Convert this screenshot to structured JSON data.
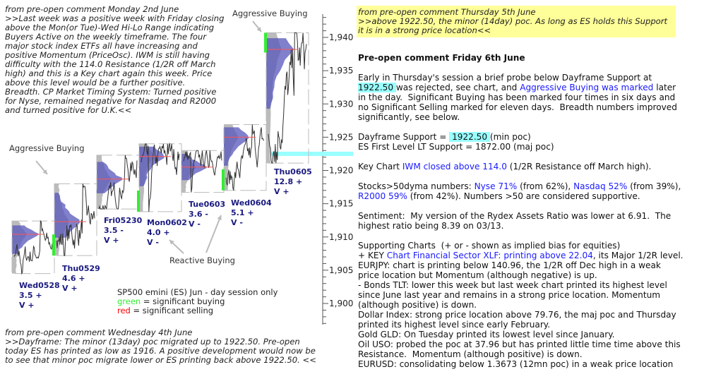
{
  "left_comment": {
    "lines": [
      "from pre-open comment Monday 2nd June",
      ">>Last week was a positive week with Friday closing",
      "above the Mon(or Tue)-Wed Hi-Lo Range indicating",
      "Buyers Active on the weekly timeframe.  The four",
      "major stock index ETFs all have increasing and",
      "positive Momentum (PriceOsc).  IWM is still having",
      "difficulty with the 114.0 Resistance (1/2R off March",
      "high) and this is a Key chart again this week. Price",
      "above this level would be a further positive.",
      "Breadth. CP Market Timing System: Turned positive",
      "for Nyse, remained negative for Nasdaq and R2000",
      "and turned positive for U.K.<<"
    ]
  },
  "bottom_comment": {
    "lines": [
      "from pre-open comment Wednesday 4th June",
      ">>Dayframe: The minor (13day) poc migrated up to 1922.50.  Pre-open",
      "today ES has printed as low as 1916.  A positive development would now be",
      "to see that minor poc migrate lower or ES printing back above 1922.50. <<"
    ]
  },
  "yellow_comment": {
    "background": "#ffff99",
    "lines": [
      "from pre-open comment Thursday 5th June",
      ">>above 1922.50, the minor (14day) poc.  As long as ES holds this Support",
      "it is in a strong price location<<"
    ]
  },
  "right_text": {
    "link_color": "#1a1aff",
    "highlight_color": "#99ffff",
    "blocks": [
      {
        "type": "title",
        "lines": [
          [
            {
              "t": "Pre-open comment Friday 6th June"
            }
          ]
        ]
      },
      {
        "type": "para",
        "lines": [
          [
            {
              "t": "Early in Thursday's session a brief probe below Dayframe Support at"
            }
          ],
          [
            {
              "t": "1922.50 ",
              "s": "hl"
            },
            {
              "t": "was rejected, see chart, and "
            },
            {
              "t": "Aggressive Buying was marked",
              "s": "link"
            },
            {
              "t": " later"
            }
          ],
          [
            {
              "t": "in the day.  Significant Buying has been marked four times in six days and"
            }
          ],
          [
            {
              "t": "no Significant Selling marked for eleven days.  Breadth numbers improved"
            }
          ],
          [
            {
              "t": "significantly, see below."
            }
          ]
        ]
      },
      {
        "type": "para",
        "lines": [
          [
            {
              "t": "Dayframe Support = "
            },
            {
              "t": " 1922.50 ",
              "s": "hl"
            },
            {
              "t": "(min poc)"
            }
          ],
          [
            {
              "t": "ES First Level LT Support = 1872.00 (maj poc)"
            }
          ]
        ]
      },
      {
        "type": "para",
        "lines": [
          [
            {
              "t": "Key Chart "
            },
            {
              "t": "IWM closed above 114.0",
              "s": "link"
            },
            {
              "t": " (1/2R Resistance off March high)."
            }
          ]
        ]
      },
      {
        "type": "para",
        "lines": [
          [
            {
              "t": "Stocks>50dyma numbers: "
            },
            {
              "t": "Nyse 71%",
              "s": "link"
            },
            {
              "t": " (from 62%), "
            },
            {
              "t": "Nasdaq 52%",
              "s": "link"
            },
            {
              "t": " (from 39%),"
            }
          ],
          [
            {
              "t": "R2000 59%",
              "s": "link"
            },
            {
              "t": " (from 42%). Numbers >50 are considered supportive."
            }
          ]
        ]
      },
      {
        "type": "para",
        "lines": [
          [
            {
              "t": "Sentiment:  My version of the Rydex Assets Ratio was lower at 6.91.  The"
            }
          ],
          [
            {
              "t": "highest ratio being 8.39 on 03/13."
            }
          ]
        ]
      },
      {
        "type": "para",
        "lines": [
          [
            {
              "t": "Supporting Charts  (+ or - shown as implied bias for equities)"
            }
          ],
          [
            {
              "t": "+ KEY "
            },
            {
              "t": "Chart Financial Sector XLF: printing above 22.04",
              "s": "link"
            },
            {
              "t": ", its Major 1/2R level."
            }
          ],
          [
            {
              "t": "EURJPY: chart is printing below 140.96, the 1/2R off Dec high in a weak"
            }
          ],
          [
            {
              "t": "price location but Momentum (although negative) is up."
            }
          ],
          [
            {
              "t": "- Bonds TLT: lower this week but last week chart printed its highest level"
            }
          ],
          [
            {
              "t": "since June last year and remains in a strong price location. Momentum"
            }
          ],
          [
            {
              "t": "(although positive) is down."
            }
          ],
          [
            {
              "t": "Dollar Index: strong price location above 79.76, the maj poc and Thursday"
            }
          ],
          [
            {
              "t": "printed its highest level since early February."
            }
          ],
          [
            {
              "t": "Gold GLD: On Tuesday printed its lowest level since January."
            }
          ],
          [
            {
              "t": "Oil USO: probed the poc at 37.96 but has printed little time time above this"
            }
          ],
          [
            {
              "t": "Resistance.  Momentum (although positive) is down."
            }
          ],
          [
            {
              "t": "EURUSD: consolidating below 1.3673 (12mn poc) in a weak price location"
            }
          ]
        ]
      }
    ]
  },
  "chart_data": {
    "type": "market-profile",
    "ylim": [
      1897,
      1943
    ],
    "yticks": [
      1900,
      1905,
      1910,
      1915,
      1920,
      1925,
      1930,
      1935,
      1940
    ],
    "ytick_labels": [
      "1,900",
      "1,905",
      "1,910",
      "1,915",
      "1,920",
      "1,925",
      "1,930",
      "1,935",
      "1,940"
    ],
    "support_line": {
      "value": 1922.5,
      "color": "#99ffff"
    },
    "colors": {
      "profile": "#5555bb",
      "profile_outer": "#aaaaaa",
      "price": "#333333",
      "poc": "#ff5555",
      "buying": "#33ee33",
      "selling": "#ff0000"
    },
    "days": [
      {
        "label": "Wed0528",
        "l2": "3.5 +",
        "l3": "V +",
        "high": 1912.4,
        "low": 1904.5,
        "open": 1906.5,
        "close": 1909.0,
        "poc": 1910.4,
        "buying": false
      },
      {
        "label": "Thu0529",
        "l2": "4.6 +",
        "l3": "V +",
        "high": 1918.0,
        "low": 1907.2,
        "open": 1909.0,
        "close": 1912.8,
        "poc": 1912.3,
        "buying": true
      },
      {
        "label": "Fri05230",
        "l2": "3.5 -",
        "l3": "V +",
        "high": 1922.3,
        "low": 1914.2,
        "open": 1913.0,
        "close": 1921.5,
        "poc": 1918.7,
        "buying": false
      },
      {
        "label": "Mon0602",
        "l2": "4.0 +",
        "l3": "V -",
        "high": 1924.0,
        "low": 1913.8,
        "open": 1921.0,
        "close": 1922.5,
        "poc": 1922.1,
        "buying": true
      },
      {
        "label": "Tue0603",
        "l2": "3.6 -",
        "l3": "V -",
        "high": 1923.0,
        "low": 1916.7,
        "open": 1922.0,
        "close": 1921.5,
        "poc": 1920.5,
        "buying": false
      },
      {
        "label": "Wed0604",
        "l2": "5.1 +",
        "l3": "V -",
        "high": 1926.9,
        "low": 1917.0,
        "open": 1918.0,
        "close": 1924.5,
        "poc": 1925.0,
        "buying": true
      },
      {
        "label": "Thu0605",
        "l2": "12.8 +",
        "l3": "V +",
        "high": 1940.7,
        "low": 1921.1,
        "open": 1924.5,
        "close": 1939.0,
        "poc": 1938.2,
        "buying": true
      }
    ],
    "annotations": {
      "aggressive_buying_1": "Aggressive Buying",
      "aggressive_buying_2": "Aggressive Buying",
      "reactive_buying": "Reactive Buying"
    },
    "legend": {
      "title": "SP500 emini  (ES)  Jun - day session only",
      "green_word": "green",
      "green_text": " = significant buying",
      "red_word": "red",
      "red_text": " = significant selling"
    }
  }
}
